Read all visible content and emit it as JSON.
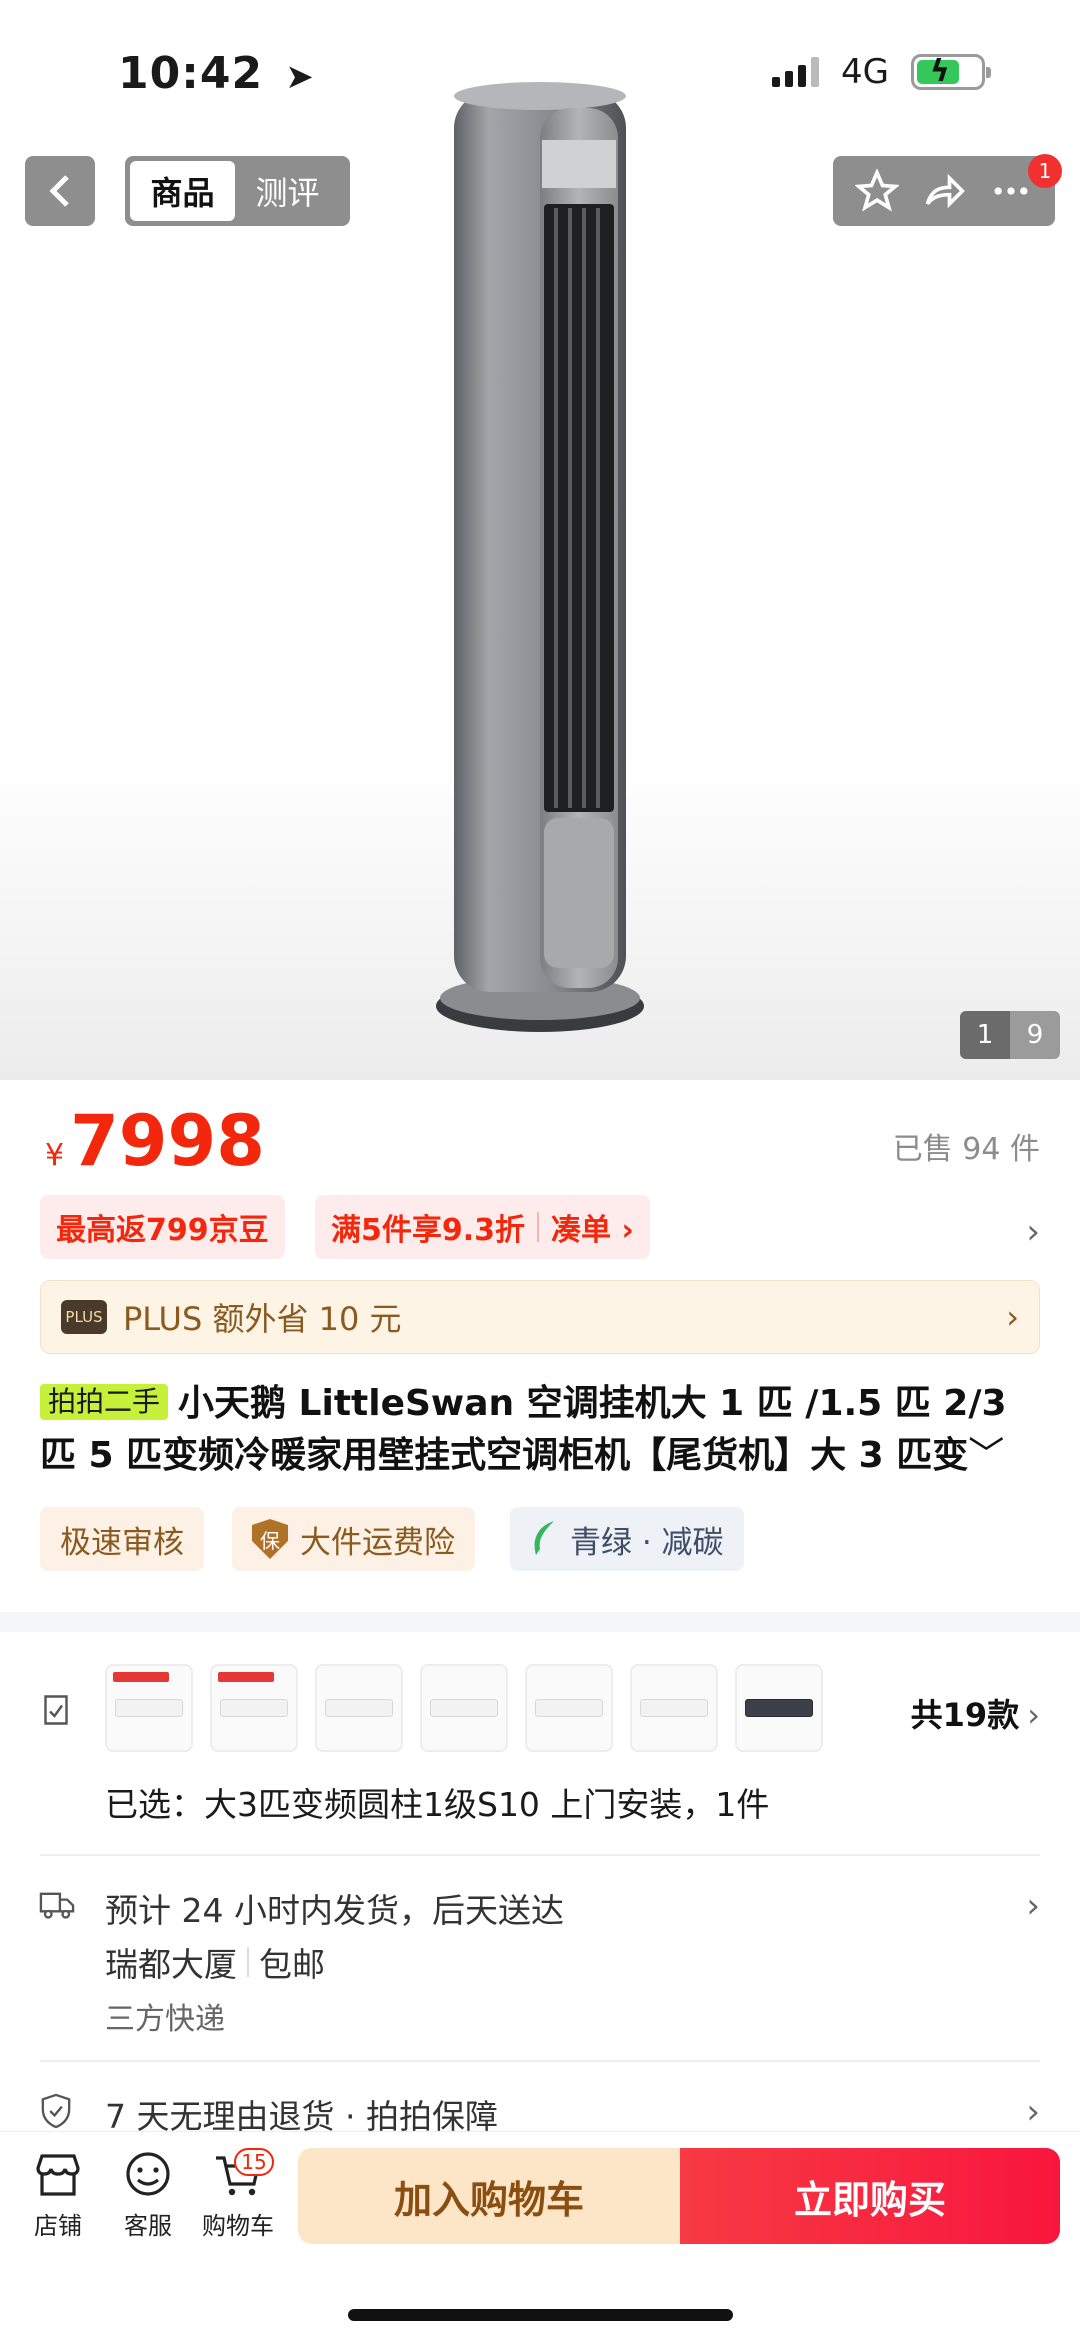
{
  "status_bar": {
    "time": "10:42",
    "network": "4G"
  },
  "header": {
    "tabs": [
      {
        "label": "商品"
      },
      {
        "label": "测评"
      }
    ],
    "notification_count": "1"
  },
  "gallery": {
    "current": "1",
    "total": "9"
  },
  "price": {
    "currency": "¥",
    "value": "7998",
    "sold": "已售 94 件"
  },
  "promos": {
    "bean": "最高返799京豆",
    "discount": "满5件享9.3折",
    "bundle": "凑单 ›"
  },
  "plus": {
    "badge": "PLUS",
    "text": "PLUS 额外省 10 元"
  },
  "product": {
    "secondhand_tag": "拍拍二手",
    "title": "小天鹅 LittleSwan 空调挂机大 1 匹 /1.5 匹 2/3 匹 5 匹变频冷暖家用壁挂式空调柜机【尾货机】大 3 匹变"
  },
  "feature_tags": {
    "fast": "极速审核",
    "shield_char": "保",
    "insurance": "大件运费险",
    "green": "青绿 · 减碳"
  },
  "variants": {
    "count_label": "共19款",
    "selected": "已选：大3匹变频圆柱1级S10 上门安装，1件"
  },
  "shipping": {
    "line1": "预计 24 小时内发货，后天送达",
    "location": "瑞都大厦",
    "postage": "包邮",
    "carrier": "三方快递"
  },
  "guarantee": {
    "text": "7 天无理由退货 · 拍拍保障"
  },
  "bottom_bar": {
    "store": "店铺",
    "service": "客服",
    "cart": "购物车",
    "cart_count": "15",
    "add_to_cart": "加入购物车",
    "buy_now": "立即购买"
  },
  "colors": {
    "accent_red": "#f2270c",
    "buy_red": "#f8163e",
    "cart_beige": "#fde5c7",
    "plus_gold": "#8a5a1e"
  }
}
